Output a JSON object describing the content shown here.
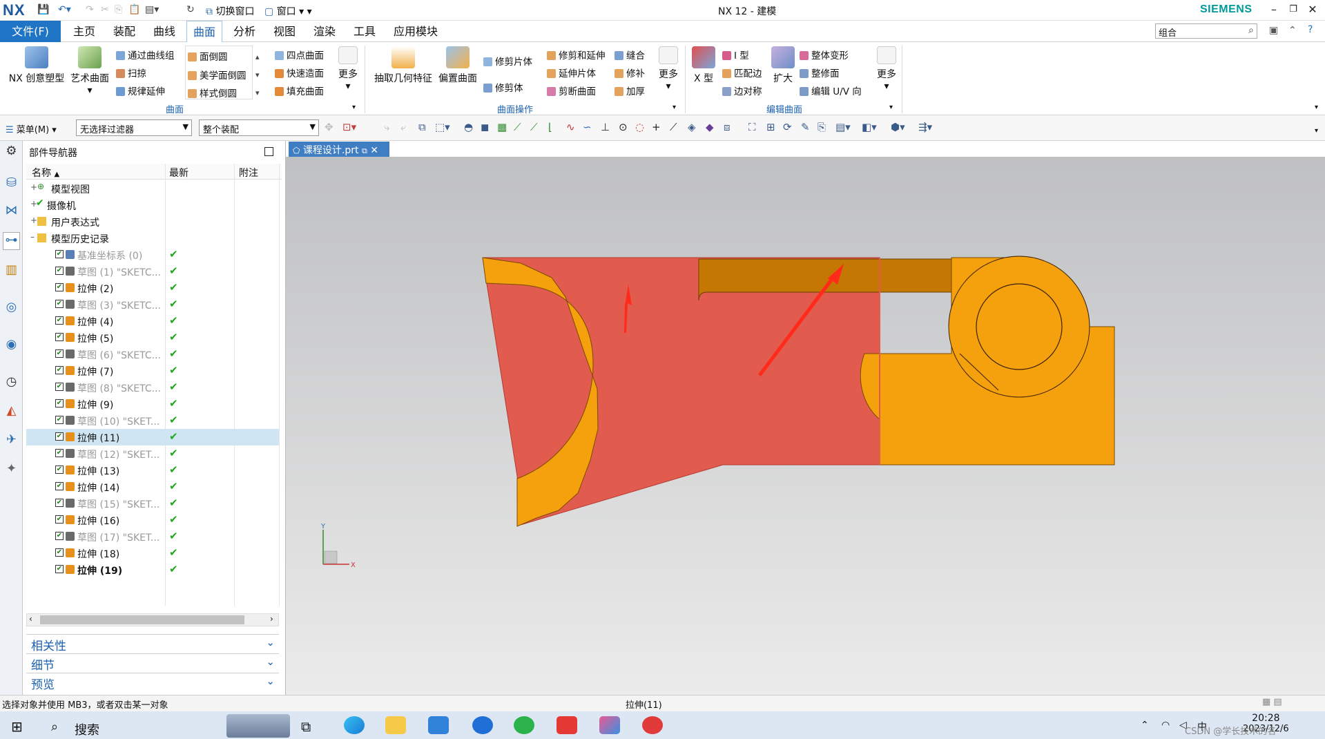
{
  "app": {
    "logo": "NX",
    "window_title": "NX 12 - 建模",
    "brand": "SIEMENS",
    "switch_window": "切换窗口",
    "window_menu": "窗口"
  },
  "menu": {
    "file": "文件(F)",
    "tabs": [
      "主页",
      "装配",
      "曲线",
      "曲面",
      "分析",
      "视图",
      "渲染",
      "工具",
      "应用模块"
    ],
    "active_tab": "曲面",
    "search_value": "组合"
  },
  "ribbon": {
    "group1": {
      "label": "曲面",
      "big": [
        "NX 创意塑型",
        "艺术曲面"
      ],
      "col1": [
        "通过曲线组",
        "扫掠",
        "规律延伸"
      ],
      "col2": [
        "面倒圆",
        "美学面倒圆",
        "样式倒圆"
      ],
      "col3": [
        "四点曲面",
        "快速造面",
        "填充曲面"
      ],
      "more": "更多"
    },
    "group2": {
      "label": "曲面操作",
      "big": [
        "抽取几何特征",
        "偏置曲面"
      ],
      "col1": [
        "修剪片体",
        "修剪体"
      ],
      "col2": [
        "修剪和延伸",
        "延伸片体",
        "剪断曲面"
      ],
      "col3": [
        "缝合",
        "修补",
        "加厚"
      ],
      "more": "更多"
    },
    "group3": {
      "label": "编辑曲面",
      "big": [
        "X 型",
        "扩大"
      ],
      "col1": [
        "I 型",
        "匹配边",
        "边对称"
      ],
      "col2": [
        "整体变形",
        "整修面",
        "编辑 U/V 向"
      ],
      "more": "更多"
    }
  },
  "toolbar2": {
    "menu": "菜单(M)",
    "filter": "无选择过滤器",
    "scope": "整个装配"
  },
  "navigator": {
    "title": "部件导航器",
    "columns": [
      "名称",
      "最新",
      "附注"
    ],
    "top_nodes": [
      "模型视图",
      "摄像机",
      "用户表达式",
      "模型历史记录"
    ],
    "rows": [
      {
        "label": "基准坐标系 (0)",
        "type": "datum",
        "grey": true
      },
      {
        "label": "草图 (1) \"SKETC...",
        "type": "sketch",
        "grey": true
      },
      {
        "label": "拉伸 (2)",
        "type": "extrude",
        "grey": false
      },
      {
        "label": "草图 (3) \"SKETC...",
        "type": "sketch",
        "grey": true
      },
      {
        "label": "拉伸 (4)",
        "type": "extrude",
        "grey": false
      },
      {
        "label": "拉伸 (5)",
        "type": "extrude",
        "grey": false
      },
      {
        "label": "草图 (6) \"SKETC...",
        "type": "sketch",
        "grey": true
      },
      {
        "label": "拉伸 (7)",
        "type": "extrude",
        "grey": false
      },
      {
        "label": "草图 (8) \"SKETC...",
        "type": "sketch",
        "grey": true
      },
      {
        "label": "拉伸 (9)",
        "type": "extrude",
        "grey": false
      },
      {
        "label": "草图 (10) \"SKET...",
        "type": "sketch",
        "grey": true
      },
      {
        "label": "拉伸 (11)",
        "type": "extrude",
        "grey": false,
        "selected": true
      },
      {
        "label": "草图 (12) \"SKET...",
        "type": "sketch",
        "grey": true
      },
      {
        "label": "拉伸 (13)",
        "type": "extrude",
        "grey": false
      },
      {
        "label": "拉伸 (14)",
        "type": "extrude",
        "grey": false
      },
      {
        "label": "草图 (15) \"SKET...",
        "type": "sketch",
        "grey": true
      },
      {
        "label": "拉伸 (16)",
        "type": "extrude",
        "grey": false
      },
      {
        "label": "草图 (17) \"SKET...",
        "type": "sketch",
        "grey": true
      },
      {
        "label": "拉伸 (18)",
        "type": "extrude",
        "grey": false
      },
      {
        "label": "拉伸 (19)",
        "type": "extrude",
        "grey": false,
        "bold": true
      }
    ],
    "panels": [
      "相关性",
      "细节",
      "预览"
    ]
  },
  "viewport": {
    "doc_tab": "课程设计.prt",
    "axis_x": "X",
    "axis_y": "Y",
    "colors": {
      "body": "#e25b4f",
      "face": "#f5a00d",
      "dark_face": "#c57703",
      "arrow": "#ff2a1a"
    }
  },
  "status": {
    "message": "选择对象并使用 MB3，或者双击某一对象",
    "selection": "拉伸(11)"
  },
  "taskbar": {
    "search": "搜索",
    "time": "20:28",
    "date": "2023/12/6",
    "watermark": "CSDN @学长技术的名"
  }
}
